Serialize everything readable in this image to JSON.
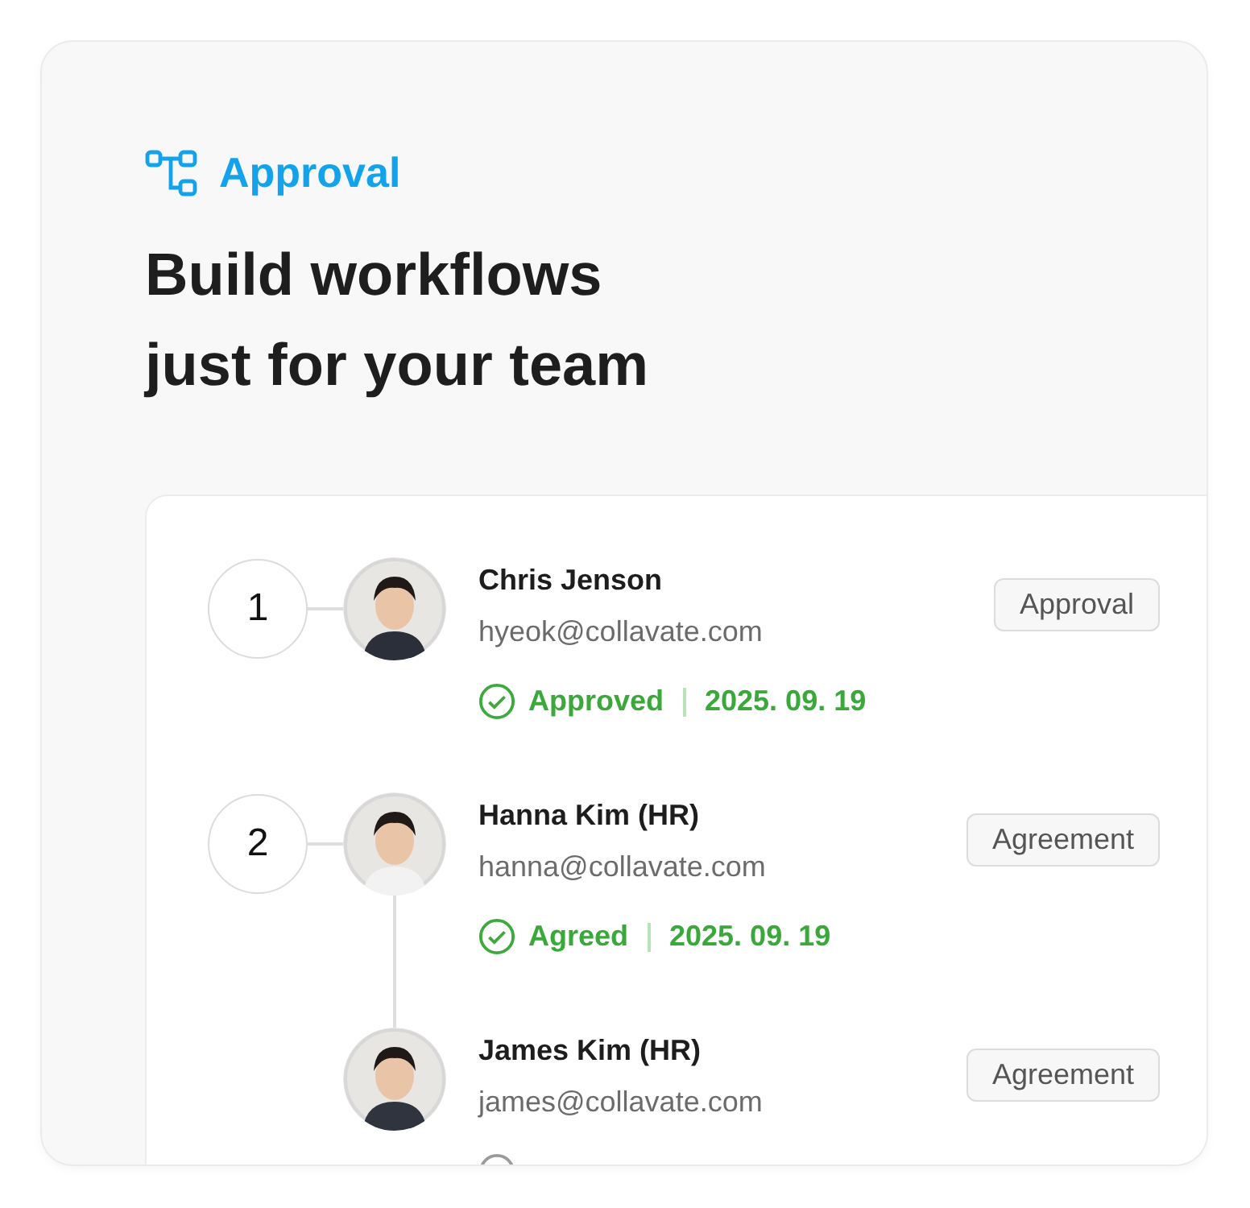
{
  "header": {
    "label": "Approval",
    "title_lines": [
      "Build workflows",
      "just for your team"
    ]
  },
  "steps": [
    {
      "number": "1",
      "approvers": [
        {
          "name": "Chris Jenson",
          "email": "hyeok@collavate.com",
          "tag": "Approval",
          "status": {
            "kind": "done",
            "label": "Approved",
            "date": "2025. 09. 19"
          }
        }
      ]
    },
    {
      "number": "2",
      "approvers": [
        {
          "name": "Hanna Kim (HR)",
          "email": "hanna@collavate.com",
          "tag": "Agreement",
          "status": {
            "kind": "done",
            "label": "Agreed",
            "date": "2025. 09. 19"
          }
        },
        {
          "name": "James Kim (HR)",
          "email": "james@collavate.com",
          "tag": "Agreement",
          "status": {
            "kind": "pending"
          }
        }
      ]
    }
  ]
}
